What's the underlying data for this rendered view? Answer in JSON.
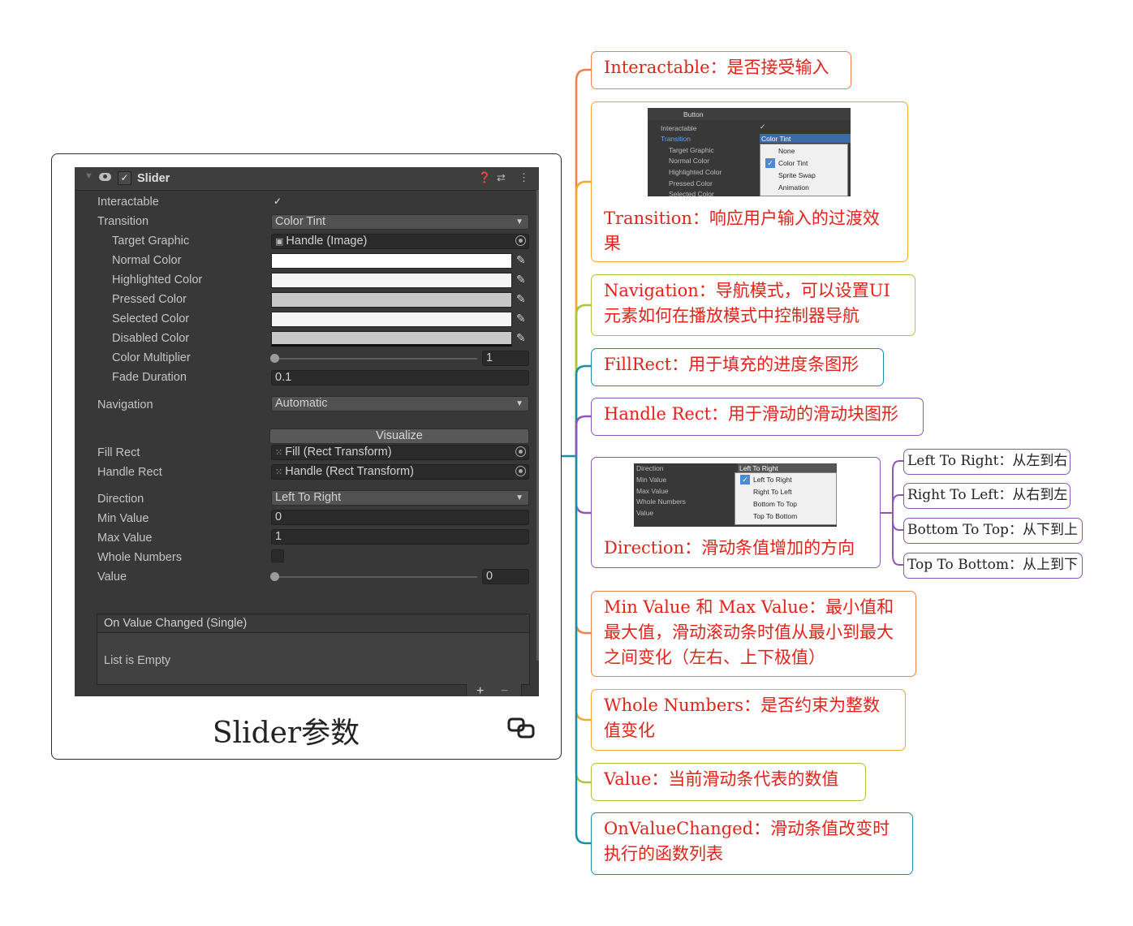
{
  "inspector": {
    "component_title": "Slider",
    "rows": {
      "interactable": "Interactable",
      "transition": "Transition",
      "transition_value": "Color Tint",
      "target_graphic": "Target Graphic",
      "target_graphic_value": "Handle (Image)",
      "normal_color": "Normal Color",
      "highlighted_color": "Highlighted Color",
      "pressed_color": "Pressed Color",
      "selected_color": "Selected Color",
      "disabled_color": "Disabled Color",
      "color_multiplier": "Color Multiplier",
      "color_multiplier_value": "1",
      "fade_duration": "Fade Duration",
      "fade_duration_value": "0.1",
      "navigation": "Navigation",
      "navigation_value": "Automatic",
      "visualize": "Visualize",
      "fill_rect": "Fill Rect",
      "fill_rect_value": "Fill (Rect Transform)",
      "handle_rect": "Handle Rect",
      "handle_rect_value": "Handle (Rect Transform)",
      "direction": "Direction",
      "direction_value": "Left To Right",
      "min_value": "Min Value",
      "min_value_value": "0",
      "max_value": "Max Value",
      "max_value_value": "1",
      "whole_numbers": "Whole Numbers",
      "value": "Value",
      "value_value": "0"
    },
    "colors": {
      "normal": "#ffffff",
      "highlighted": "#f5f5f5",
      "pressed": "#c8c8c8",
      "selected": "#f5f5f5",
      "disabled": "#c8c8c8"
    },
    "event": {
      "header": "On Value Changed (Single)",
      "body": "List is Empty",
      "add": "+",
      "remove": "−"
    }
  },
  "card_caption": "Slider参数",
  "nodes": {
    "interactable": "Interactable：是否接受输入",
    "transition": "Transition：响应用户输入的过渡效果",
    "navigation": "Navigation：导航模式，可以设置UI元素如何在播放模式中控制器导航",
    "fillrect": "FillRect：用于填充的进度条图形",
    "handlerect": "Handle Rect：用于滑动的滑动块图形",
    "direction": "Direction：滑动条值增加的方向",
    "minmax": "Min Value 和 Max Value：最小值和最大值，滑动滚动条时值从最小到最大之间变化（左右、上下极值）",
    "whole": "Whole Numbers：是否约束为整数值变化",
    "value": "Value：当前滑动条代表的数值",
    "onvalue": "OnValueChanged：滑动条值改变时执行的函数列表"
  },
  "leaves": {
    "ltr": "Left To Right：从左到右",
    "rtl": "Right To Left：从右到左",
    "btt": "Bottom To Top：从下到上",
    "ttb": "Top To Bottom：从上到下"
  },
  "mini_button": {
    "title": "Button",
    "interactable": "Interactable",
    "transition": "Transition",
    "target_graphic": "Target Graphic",
    "normal_color": "Normal Color",
    "highlighted_color": "Highlighted Color",
    "pressed_color": "Pressed Color",
    "selected_color": "Selected Color",
    "selected_value": "Color Tint",
    "options": [
      "None",
      "Color Tint",
      "Sprite Swap",
      "Animation"
    ]
  },
  "mini_direction": {
    "direction": "Direction",
    "min_value": "Min Value",
    "max_value": "Max Value",
    "whole_numbers": "Whole Numbers",
    "value": "Value",
    "selected_value": "Left To Right",
    "options": [
      "Left To Right",
      "Right To Left",
      "Bottom To Top",
      "Top To Bottom"
    ]
  },
  "branch_colors": [
    "#f08048",
    "#f5a830",
    "#a8c838",
    "#1a8fa8",
    "#8e57b4",
    "#8e57b4",
    "#f08048",
    "#f5a830",
    "#a8c838",
    "#1a8fa8"
  ]
}
